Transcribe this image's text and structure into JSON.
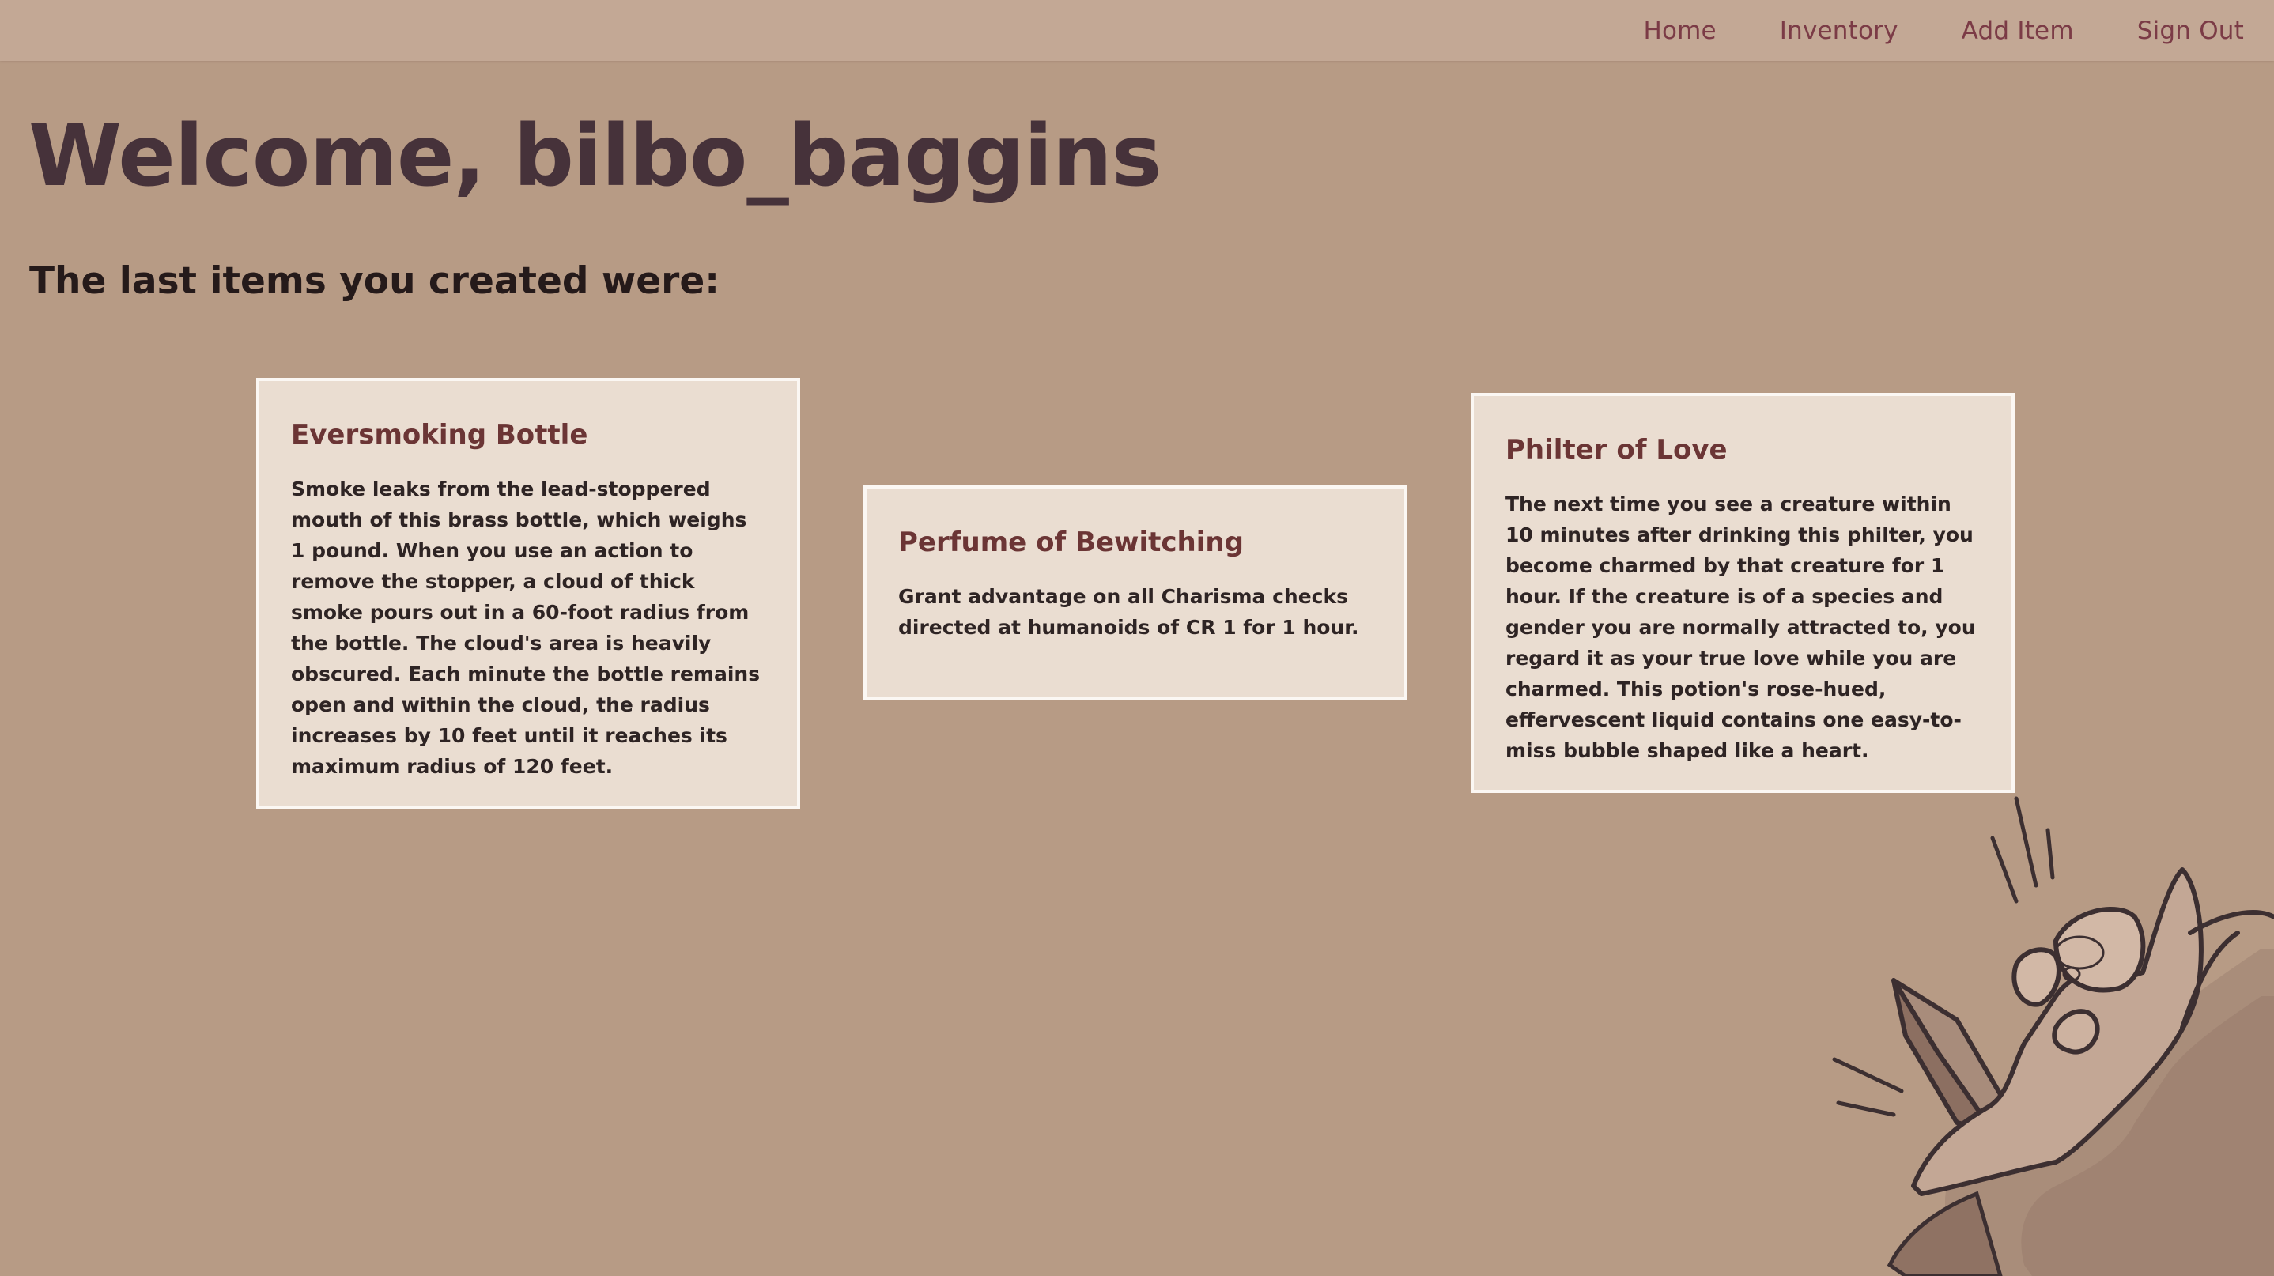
{
  "nav": {
    "items": [
      {
        "label": "Home"
      },
      {
        "label": "Inventory"
      },
      {
        "label": "Add Item"
      },
      {
        "label": "Sign Out"
      }
    ]
  },
  "main": {
    "welcome": "Welcome, bilbo_baggins",
    "subtitle": "The last items you created were:"
  },
  "items": [
    {
      "title": "Eversmoking Bottle",
      "description": "Smoke leaks from the lead-stoppered mouth of this brass bottle, which weighs 1 pound. When you use an action to remove the stopper, a cloud of thick smoke pours out in a 60-foot radius from the bottle. The cloud's area is heavily obscured. Each minute the bottle remains open and within the cloud, the radius increases by 10 feet until it reaches its maximum radius of 120 feet."
    },
    {
      "title": "Perfume of Bewitching",
      "description": "Grant advantage on all Charisma checks directed at humanoids of CR 1 for 1 hour."
    },
    {
      "title": "Philter of Love",
      "description": "The next time you see a creature within 10 minutes after drinking this philter, you become charmed by that creature for 1 hour. If the creature is of a species and gender you are normally attracted to, you regard it as your true love while you are charmed. This potion's rose-hued, effervescent liquid contains one easy-to-miss bubble shaped like a heart."
    }
  ],
  "colors": {
    "background": "#b79b85",
    "navbar": "#c3a895",
    "nav_link": "#7b3b46",
    "card_bg": "#eaddd1",
    "card_border": "#fbf7f3",
    "card_title": "#6b3535",
    "heading": "#46323a"
  },
  "illustration": {
    "icon": "hand-holding-crystal-icon"
  }
}
